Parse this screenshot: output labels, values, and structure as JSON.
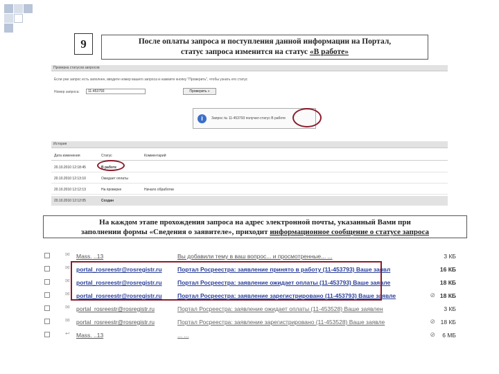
{
  "slide": {
    "step_number": "9",
    "header_line1": "После оплаты запроса и поступления данной информации на Портал,",
    "header_line2_prefix": "статус запроса изменится на статус ",
    "header_line2_status": "«В работе»",
    "caption_line1": "На каждом этапе прохождения запроса на адрес электронной почты, указанный Вами при",
    "caption_line2_prefix": "заполнении формы «Сведения о заявителе», приходит ",
    "caption_line2_link": "информационное сообщение о статусе запроса"
  },
  "status_page": {
    "title": "Проверка статусов запросов",
    "instruction": "Если уже запрос есть заполнен, вводите номер вашего запроса и нажмите кнопку \"Проверить\", чтобы узнать его статус",
    "request_number_label": "Номер запроса:",
    "request_number_value": "11-453793",
    "check_button": "Проверить »",
    "message": "Запрос № 11-453793 получил статус В работе",
    "history_title": "История",
    "columns": [
      "Дата изменения",
      "Статус",
      "Комментарий"
    ],
    "history": [
      {
        "date": "20.10.2010 12:18:45",
        "status": "В работе",
        "comment": ""
      },
      {
        "date": "20.10.2010 12:13:10",
        "status": "Ожидает оплаты",
        "comment": ""
      },
      {
        "date": "20.10.2010 12:12:13",
        "status": "На проверке",
        "comment": "Начало обработки"
      },
      {
        "date": "20.10.2010 12:12:05",
        "status": "Создан",
        "comment": ""
      }
    ]
  },
  "mail_list": [
    {
      "from": "Mass. ..13",
      "subject": "Вы добавили тему в ваш вопрос... и просмотренные... ...",
      "size": "3 КБ",
      "attach": false,
      "bold": false
    },
    {
      "from": "portal_rosreestr@rosregistr.ru",
      "subject": "Портал Росреестра: заявление принято в работу (11-453793) Ваше заявл",
      "size": "16 КБ",
      "attach": false,
      "bold": true
    },
    {
      "from": "portal_rosreestr@rosregistr.ru",
      "subject": "Портал Росреестра: заявление ожидает оплаты (11-453793) Ваше заявле",
      "size": "18 КБ",
      "attach": false,
      "bold": true
    },
    {
      "from": "portal_rosreestr@rosregistr.ru",
      "subject": "Портал Росреестра: заявление зарегистрировано (11-453793) Ваше заявле",
      "size": "18 КБ",
      "attach": true,
      "bold": true
    },
    {
      "from": "portal_rosreestr@rosregistr.ru",
      "subject": "Портал Росреестра: заявление ожидает оплаты (11-453528) Ваше заявлен",
      "size": "3 КБ",
      "attach": false,
      "bold": false
    },
    {
      "from": "portal_rosreestr@rosregistr.ru",
      "subject": "Портал Росреестра: заявление зарегистрировано (11-453528) Ваше заявле",
      "size": "18 КБ",
      "attach": true,
      "bold": false
    },
    {
      "from": "Mass. ..13",
      "subject": "... ...",
      "size": "6 МБ",
      "attach": true,
      "bold": false
    }
  ]
}
